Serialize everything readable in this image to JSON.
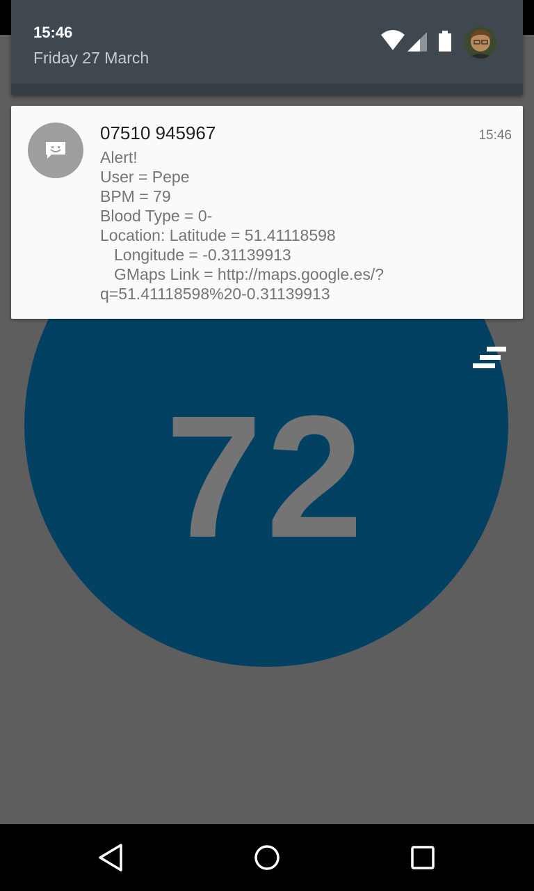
{
  "shade": {
    "time": "15:46",
    "date": "Friday 27 March"
  },
  "status_icons": [
    "wifi-icon",
    "cell-signal-icon",
    "battery-icon",
    "user-avatar"
  ],
  "notification": {
    "icon": "message-smile-icon",
    "title": "07510 945967",
    "time": "15:46",
    "lines": [
      "Alert!",
      "User = Pepe",
      "BPM = 79",
      "Blood Type = 0-",
      "Location: Latitude = 51.41118598",
      "Longitude = -0.31139913",
      "GMaps Link = http://maps.google.es/?",
      "q=51.41118598%20-0.31139913"
    ]
  },
  "app": {
    "bpm_value": "72",
    "menu_icon": "sort-menu-icon",
    "circle_color": "#034163"
  },
  "nav": {
    "back": "back-icon",
    "home": "home-icon",
    "recents": "recents-icon"
  }
}
